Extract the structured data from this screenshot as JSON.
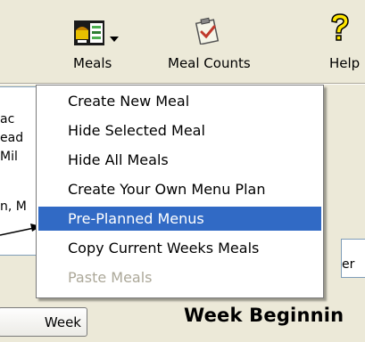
{
  "toolbar": {
    "meals": {
      "label": "Meals",
      "icon": "meals-icon"
    },
    "meal_counts": {
      "label": "Meal Counts",
      "icon": "clipboard-check-icon"
    },
    "help": {
      "label": "Help",
      "icon": "question-mark-icon"
    }
  },
  "background": {
    "list_fragments": [
      "ac",
      "ead",
      "Mil",
      "n, M"
    ],
    "right_fragment": "er",
    "week_button_label": "Week",
    "week_title": "Week Beginnin"
  },
  "meals_menu": {
    "items": [
      {
        "label": "Create New Meal",
        "state": "normal"
      },
      {
        "label": "Hide Selected Meal",
        "state": "normal"
      },
      {
        "label": "Hide All Meals",
        "state": "normal"
      },
      {
        "label": "Create Your Own Menu Plan",
        "state": "normal"
      },
      {
        "label": "Pre-Planned Menus",
        "state": "highlighted"
      },
      {
        "label": "Copy Current Weeks Meals",
        "state": "normal"
      },
      {
        "label": "Paste Meals",
        "state": "disabled"
      }
    ]
  },
  "colors": {
    "toolbar_bg": "#ece9d8",
    "highlight": "#316ac5",
    "disabled_text": "#aca899"
  }
}
